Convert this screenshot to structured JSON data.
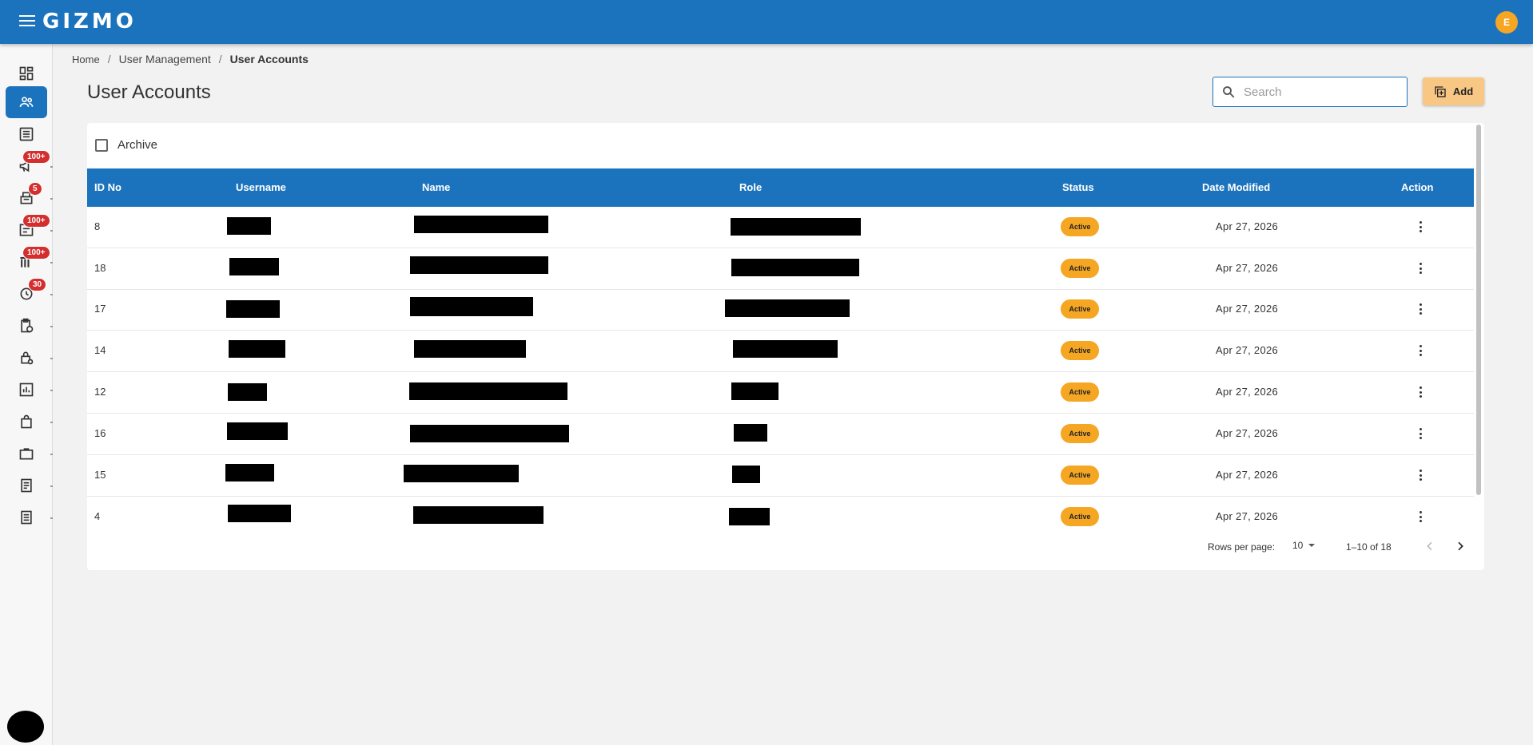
{
  "app": {
    "logo": "GIZMO",
    "user_initial": "E"
  },
  "sidebar": {
    "items": [
      {
        "icon": "dashboard-icon"
      },
      {
        "icon": "users-icon",
        "active": true
      },
      {
        "icon": "list-icon"
      },
      {
        "icon": "megaphone-icon",
        "badge": "100+"
      },
      {
        "icon": "register-icon",
        "badge": "5"
      },
      {
        "icon": "checklist-icon",
        "badge": "100+"
      },
      {
        "icon": "bars-icon",
        "badge": "100+"
      },
      {
        "icon": "clock-icon",
        "badge": "30"
      },
      {
        "icon": "clipboard-clock-icon"
      },
      {
        "icon": "lock-icon"
      },
      {
        "icon": "chart-icon"
      },
      {
        "icon": "bag-icon"
      },
      {
        "icon": "briefcase-icon"
      },
      {
        "icon": "receipt-icon"
      },
      {
        "icon": "receipt-icon-2"
      }
    ]
  },
  "breadcrumb": {
    "home": "Home",
    "section": "User Management",
    "current": "User Accounts"
  },
  "page": {
    "title": "User Accounts"
  },
  "search": {
    "placeholder": "Search",
    "value": ""
  },
  "toolbar": {
    "add_label": "Add"
  },
  "filters": {
    "archive_label": "Archive",
    "archive_checked": false
  },
  "table": {
    "columns": [
      "ID No",
      "Username",
      "Name",
      "Role",
      "Status",
      "Date Modified",
      "Action"
    ],
    "rows": [
      {
        "id": "8",
        "status": "Active",
        "date": "Apr 27, 2026"
      },
      {
        "id": "18",
        "status": "Active",
        "date": "Apr 27, 2026"
      },
      {
        "id": "17",
        "status": "Active",
        "date": "Apr 27, 2026"
      },
      {
        "id": "14",
        "status": "Active",
        "date": "Apr 27, 2026"
      },
      {
        "id": "12",
        "status": "Active",
        "date": "Apr 27, 2026"
      },
      {
        "id": "16",
        "status": "Active",
        "date": "Apr 27, 2026"
      },
      {
        "id": "15",
        "status": "Active",
        "date": "Apr 27, 2026"
      },
      {
        "id": "4",
        "status": "Active",
        "date": "Apr 27, 2026"
      }
    ]
  },
  "pagination": {
    "rows_per_page_label": "Rows per page:",
    "rows_per_page": "10",
    "range": "1–10 of 18"
  },
  "colors": {
    "primary": "#1c73bd",
    "status_active": "#f5a623",
    "badge": "#d32f2f",
    "add_button": "#f9c784"
  }
}
